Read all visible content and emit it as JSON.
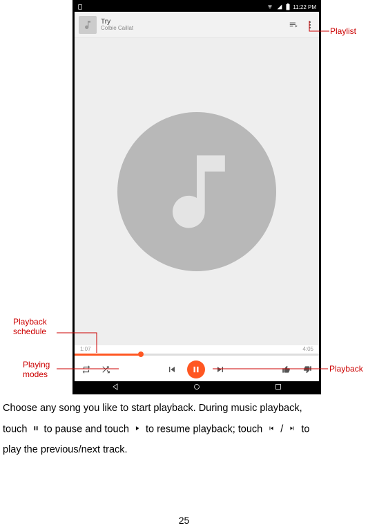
{
  "status": {
    "time": "11:22 PM"
  },
  "topbar": {
    "song_title": "Try",
    "song_artist": "Colbie Caillat"
  },
  "playback": {
    "elapsed": "1:07",
    "total": "4:05",
    "progress_percent": 27
  },
  "annotations": {
    "playlist": "Playlist",
    "schedule_line1": "Playback",
    "schedule_line2": "schedule",
    "modes_line1": "Playing",
    "modes_line2": "modes",
    "playback": "Playback"
  },
  "instructions": {
    "line1a": "Choose any song you like to start playback. During music playback,",
    "line2a": "touch",
    "line2b": "to pause and touch",
    "line2c": "to resume playback; touch",
    "line2d": "/",
    "line2e": "to",
    "line3": "play the previous/next track."
  },
  "page_number": "25"
}
